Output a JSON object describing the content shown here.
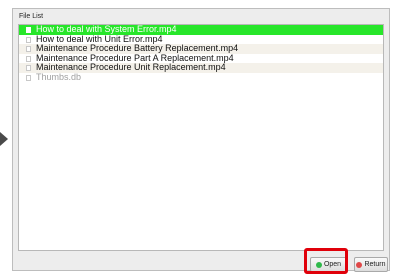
{
  "panel": {
    "title": "File List"
  },
  "files": [
    {
      "name": "How to deal with System Error.mp4"
    },
    {
      "name": "How to deal with Unit Error.mp4"
    },
    {
      "name": "Maintenance Procedure Battery Replacement.mp4"
    },
    {
      "name": "Maintenance Procedure Part A Replacement.mp4"
    },
    {
      "name": "Maintenance Procedure Unit Replacement.mp4"
    },
    {
      "name": "Thumbs.db"
    }
  ],
  "buttons": {
    "open_label": "Open",
    "return_label": "Return"
  },
  "colors": {
    "selection": "#27e62a",
    "highlight": "#e0000a",
    "open_icon": "#2fb94a",
    "return_icon": "#e04848"
  },
  "icons": {
    "pointer": "arrow-right-icon",
    "file": "file-icon",
    "open": "green-circle-icon",
    "return": "red-circle-icon"
  }
}
